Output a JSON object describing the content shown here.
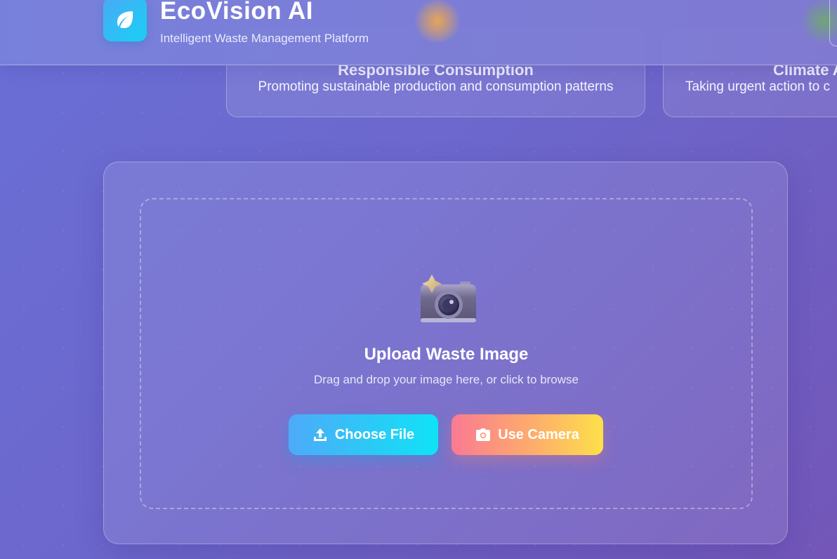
{
  "header": {
    "app_title": "EcoVision AI",
    "app_subtitle": "Intelligent Waste Management Platform",
    "logo_icon": "leaf-icon"
  },
  "sdg_cards": [
    {
      "title": "Responsible Consumption",
      "description": "Promoting sustainable production and consumption patterns"
    },
    {
      "title": "Climate A",
      "description": "Taking urgent action to c"
    }
  ],
  "upload": {
    "icon": "camera-sparkle-icon",
    "title": "Upload Waste Image",
    "hint": "Drag and drop your image here, or click to browse",
    "choose_file_label": "Choose File",
    "choose_file_icon": "upload-icon",
    "use_camera_label": "Use Camera",
    "use_camera_icon": "camera-icon"
  },
  "colors": {
    "background": "#6c67cc",
    "choose_file_gradient": [
      "#4eaaf8",
      "#0fe3f5"
    ],
    "use_camera_gradient": [
      "#fa7a92",
      "#fde04a"
    ],
    "logo_gradient": [
      "#4ba9f5",
      "#18d0f5"
    ]
  }
}
